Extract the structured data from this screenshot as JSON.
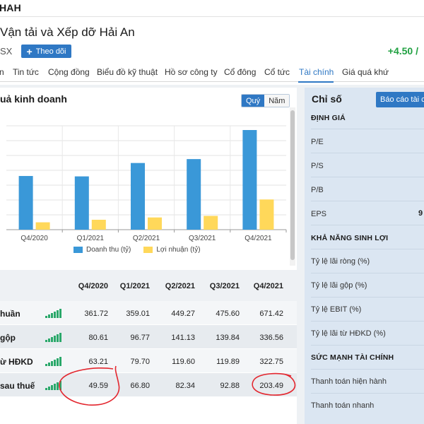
{
  "header": {
    "ticker": "HAH",
    "company_name": "Vận tải và Xếp dỡ Hải An",
    "exchange": "SX",
    "follow_label": "Theo dõi",
    "price_change": "+4.50 /"
  },
  "nav": {
    "items": [
      "n",
      "Tin tức",
      "Cộng đồng",
      "Biểu đồ kỹ thuật",
      "Hồ sơ công ty",
      "Cổ đông",
      "Cổ tức",
      "Tài chính",
      "Giá quá khứ"
    ],
    "active": "Tài chính"
  },
  "business": {
    "title": "uả kinh doanh",
    "toggle": [
      "Quý",
      "Năm"
    ],
    "toggle_active": "Quý"
  },
  "chart_data": {
    "type": "bar",
    "categories": [
      "Q4/2020",
      "Q1/2021",
      "Q2/2021",
      "Q3/2021",
      "Q4/2021"
    ],
    "series": [
      {
        "name": "Doanh thu (tỷ)",
        "values": [
          361.72,
          359.01,
          449.27,
          475.6,
          671.42
        ],
        "color": "#3a98d8"
      },
      {
        "name": "Lợi nhuận (tỷ)",
        "values": [
          49.59,
          66.8,
          82.34,
          92.88,
          203.49
        ],
        "color": "#ffd85a"
      }
    ],
    "ylim": [
      0,
      700
    ],
    "grid": true,
    "legend": "bottom"
  },
  "table": {
    "columns": [
      "Q4/2020",
      "Q1/2021",
      "Q2/2021",
      "Q3/2021",
      "Q4/2021"
    ],
    "rows": [
      {
        "label": "huần",
        "values": [
          "361.72",
          "359.01",
          "449.27",
          "475.60",
          "671.42"
        ]
      },
      {
        "label": "gộp",
        "values": [
          "80.61",
          "96.77",
          "141.13",
          "139.84",
          "336.56"
        ]
      },
      {
        "label": "ừ HĐKD",
        "values": [
          "63.21",
          "79.70",
          "119.60",
          "119.89",
          "322.75"
        ]
      },
      {
        "label": "sau thuế",
        "values": [
          "49.59",
          "66.80",
          "82.34",
          "92.88",
          "203.49"
        ]
      }
    ]
  },
  "ratios": {
    "title": "Chỉ số",
    "report_button": "Báo cáo tài c",
    "sections": [
      {
        "heading": "ĐỊNH GIÁ",
        "items": [
          "P/E",
          "P/S",
          "P/B",
          "EPS"
        ]
      },
      {
        "heading": "KHẢ NĂNG SINH LỢI",
        "items": [
          "Tỷ lệ lãi ròng (%)",
          "Tỷ lệ lãi gộp (%)",
          "Tỷ lệ EBIT (%)",
          "Tỷ lệ lãi từ HĐKD (%)"
        ]
      },
      {
        "heading": "SỨC MẠNH TÀI CHÍNH",
        "items": [
          "Thanh toán hiện hành",
          "Thanh toán nhanh"
        ]
      }
    ],
    "eps_value": "9"
  },
  "colors": {
    "accent": "#2f78c4",
    "positive": "#21a142",
    "spark": "#2aa86a",
    "annotation": "#e3262e"
  }
}
